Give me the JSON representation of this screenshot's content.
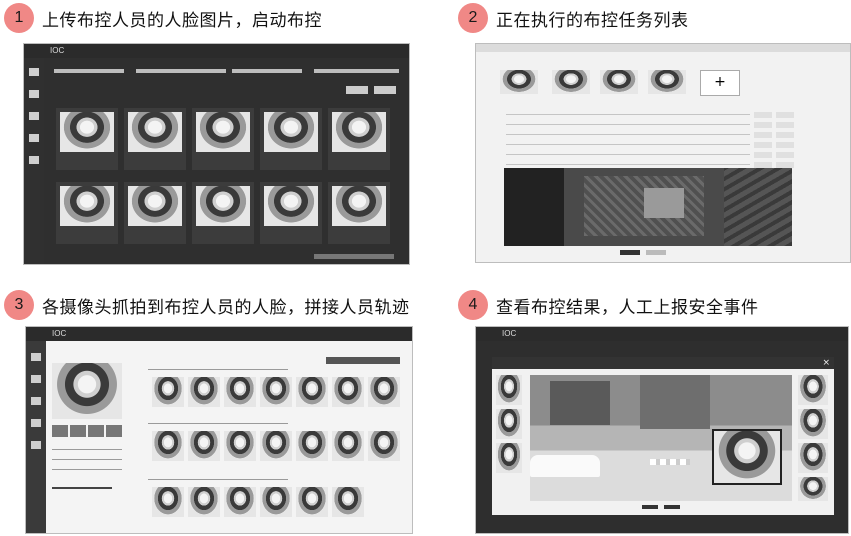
{
  "steps": [
    {
      "num": "1",
      "title": "上传布控人员的人脸图片，启动布控"
    },
    {
      "num": "2",
      "title": "正在执行的布控任务列表"
    },
    {
      "num": "3",
      "title": "各摄像头抓拍到布控人员的人脸，拼接人员轨迹"
    },
    {
      "num": "4",
      "title": "查看布控结果，人工上报安全事件"
    }
  ],
  "screens": {
    "s1": {
      "logo": "IOC"
    },
    "s3": {
      "logo": "IOC"
    },
    "s4": {
      "logo": "IOC"
    }
  }
}
